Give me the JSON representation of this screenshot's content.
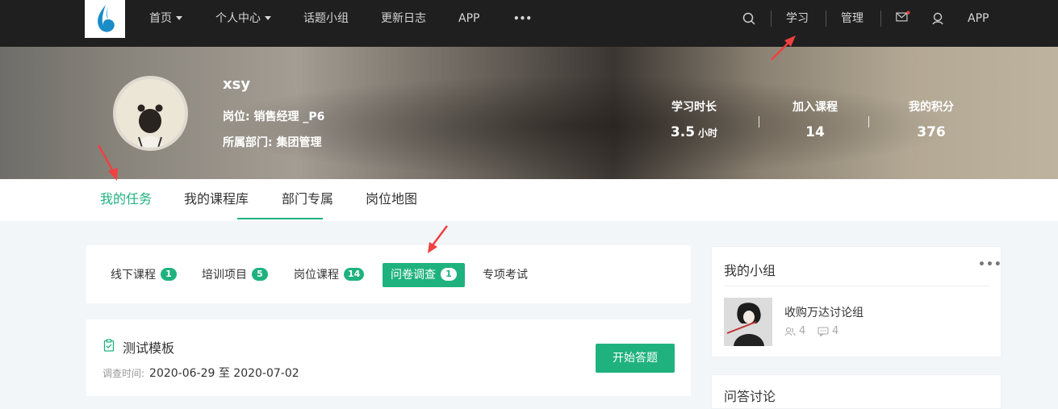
{
  "nav": {
    "items": [
      {
        "label": "首页",
        "caret": true
      },
      {
        "label": "个人中心",
        "caret": true
      },
      {
        "label": "话题小组",
        "caret": false
      },
      {
        "label": "更新日志",
        "caret": false
      },
      {
        "label": "APP",
        "caret": false
      },
      {
        "label": "•••",
        "caret": false
      }
    ],
    "right": {
      "search_icon": "search-icon",
      "study": "学习",
      "manage": "管理",
      "mail_icon": "mail-icon",
      "user_icon": "user-icon",
      "app": "APP"
    }
  },
  "profile": {
    "name": "xsy",
    "position": "岗位: 销售经理 _P6",
    "department": "所属部门: 集团管理",
    "stats": [
      {
        "label": "学习时长",
        "value": "3.5",
        "unit": "小时"
      },
      {
        "label": "加入课程",
        "value": "14",
        "unit": ""
      },
      {
        "label": "我的积分",
        "value": "376",
        "unit": ""
      }
    ]
  },
  "main_tabs": [
    "我的任务",
    "我的课程库",
    "部门专属",
    "岗位地图"
  ],
  "sub_tabs": [
    {
      "label": "线下课程",
      "badge": "1"
    },
    {
      "label": "培训项目",
      "badge": "5"
    },
    {
      "label": "岗位课程",
      "badge": "14"
    },
    {
      "label": "问卷调查",
      "badge": "1"
    },
    {
      "label": "专项考试",
      "badge": ""
    }
  ],
  "survey": {
    "title": "测试模板",
    "date_label": "调查时间:",
    "date_range": "2020-06-29 至 2020-07-02",
    "button": "开始答题"
  },
  "sidebar": {
    "groups_title": "我的小组",
    "more": "•••",
    "group": {
      "name": "收购万达讨论组",
      "members": "4",
      "posts": "4"
    },
    "qa_title": "问答讨论"
  },
  "colors": {
    "accent": "#1fb27f",
    "nav_bg": "#1f1f1f",
    "arrow": "#f04040"
  }
}
